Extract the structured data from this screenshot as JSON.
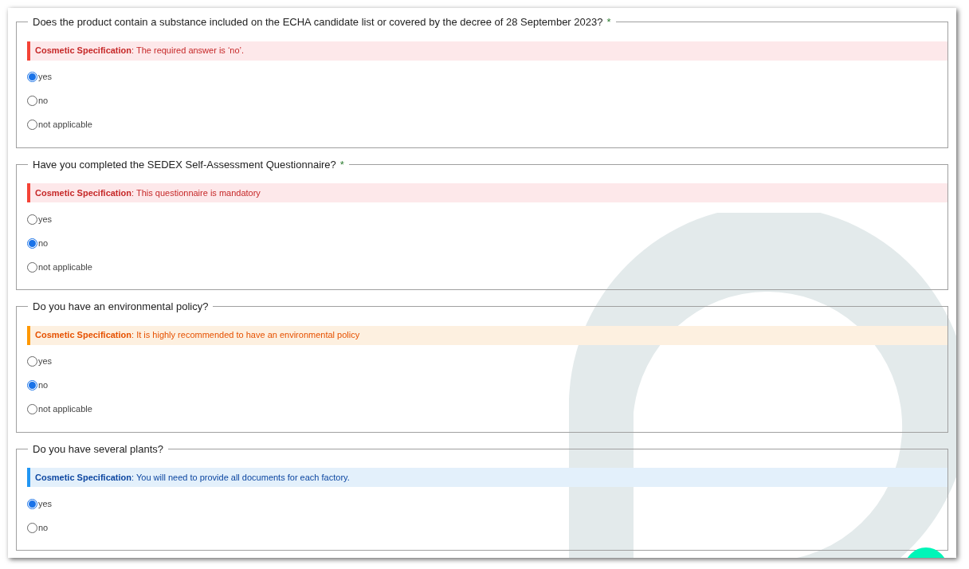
{
  "questions": [
    {
      "question": "Does the product contain a substance included on the ECHA candidate list or covered by the decree of 28 September 2023?",
      "required_mark": "*",
      "alert": {
        "kind": "error",
        "label": "Cosmetic Specification",
        "message": ": The required answer is ‘no’."
      },
      "options": [
        {
          "label": "yes",
          "selected": true
        },
        {
          "label": "no",
          "selected": false
        },
        {
          "label": "not applicable",
          "selected": false
        }
      ]
    },
    {
      "question": "Have you completed the SEDEX Self-Assessment Questionnaire?",
      "required_mark": "*",
      "alert": {
        "kind": "error",
        "label": "Cosmetic Specification",
        "message": ": This questionnaire is mandatory"
      },
      "options": [
        {
          "label": "yes",
          "selected": false
        },
        {
          "label": "no",
          "selected": true
        },
        {
          "label": "not applicable",
          "selected": false
        }
      ]
    },
    {
      "question": "Do you have an environmental policy?",
      "alert": {
        "kind": "warning",
        "label": "Cosmetic Specification",
        "message": ": It is highly recommended to have an environmental policy"
      },
      "options": [
        {
          "label": "yes",
          "selected": false
        },
        {
          "label": "no",
          "selected": true
        },
        {
          "label": "not applicable",
          "selected": false
        }
      ]
    },
    {
      "question": "Do you have several plants?",
      "alert": {
        "kind": "info",
        "label": "Cosmetic Specification",
        "message": ": You will need to provide all documents for each factory."
      },
      "options": [
        {
          "label": "yes",
          "selected": true
        },
        {
          "label": "no",
          "selected": false
        }
      ]
    }
  ]
}
